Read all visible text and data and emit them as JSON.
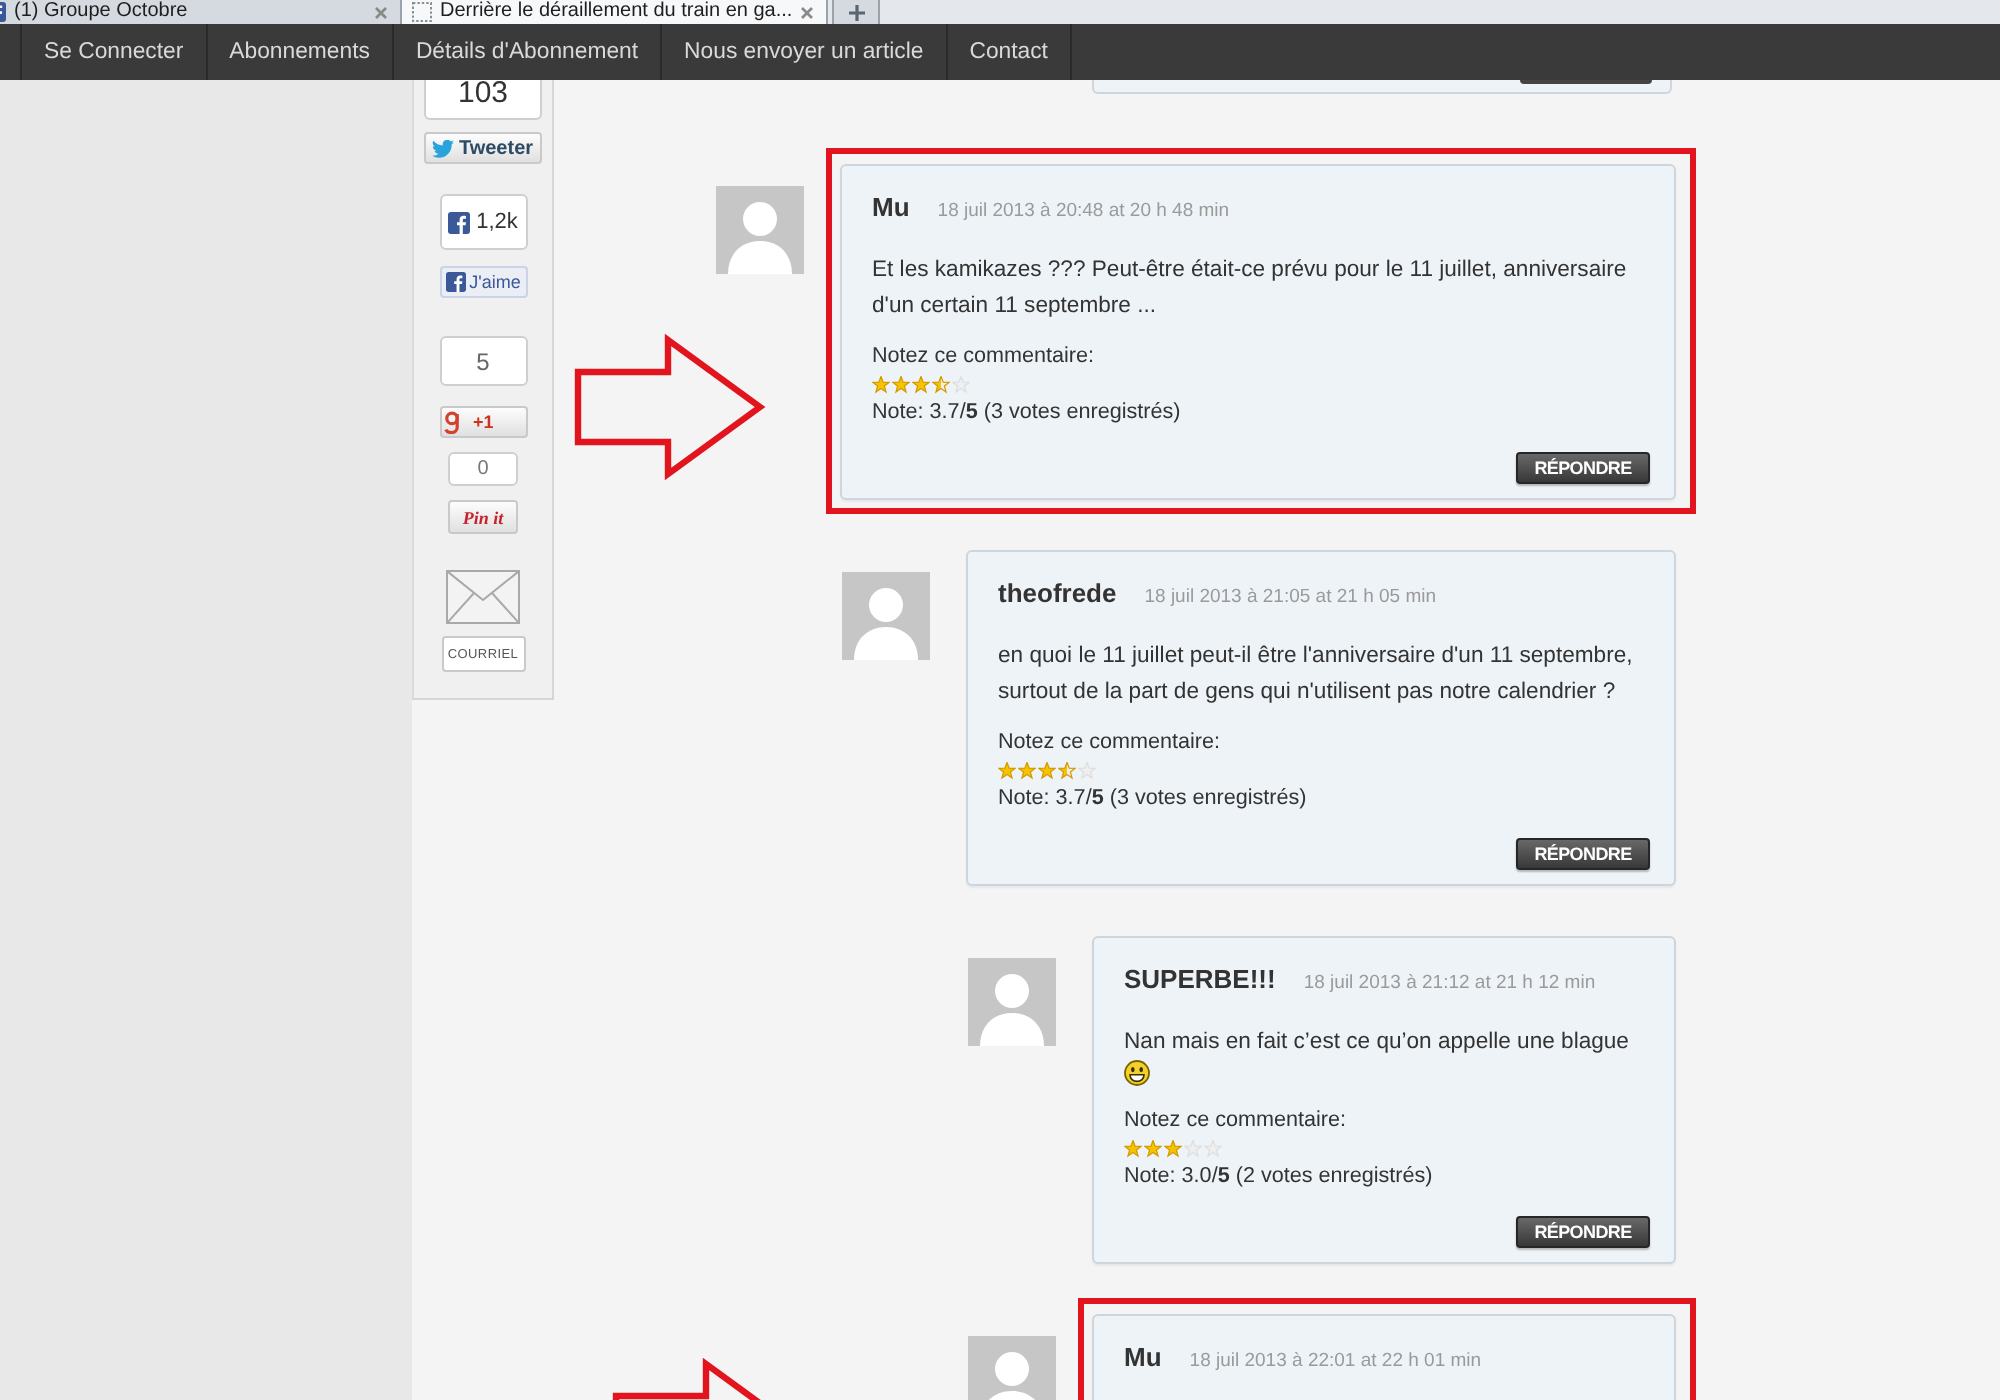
{
  "browser": {
    "tabs": [
      {
        "kind": "site",
        "title": "(1) Groupe Octobre",
        "selected": false
      },
      {
        "kind": "blank",
        "title": "Derrière le déraillement du train en ga...",
        "selected": true
      }
    ]
  },
  "nav": {
    "items": [
      "Se Connecter",
      "Abonnements",
      "Détails d'Abonnement",
      "Nous envoyer un article",
      "Contact"
    ]
  },
  "share_bar": [
    {
      "kind": "twitter",
      "count": "103",
      "label": "Tweeter"
    },
    {
      "kind": "facebook",
      "count": "1,2k",
      "label": "J'aime"
    },
    {
      "kind": "google",
      "count": "5",
      "label": "+1"
    },
    {
      "kind": "pinterest",
      "count": "0",
      "label": "Pin it"
    },
    {
      "kind": "email",
      "label": "COURRIEL"
    }
  ],
  "comments": [
    {
      "author": "Mu",
      "date": "18 juil 2013 à 20:48 at 20 h 48 min",
      "body": "Et les kamikazes ??? Peut-être était-ce prévu pour le 11 juillet, anniversaire d'un certain 11 septembre ...",
      "rating_prompt": "Notez ce commentaire:",
      "stars": 3.5,
      "note": "Note: 3.7/**5** (3 votes enregistrés)",
      "reply": "RÉPONDRE",
      "highlighted": true,
      "children": [
        {
          "author": "theofrede",
          "date": "18 juil 2013 à 21:05 at 21 h 05 min",
          "body": "en quoi le 11 juillet peut-il être l'anniversaire d'un 11 septembre, surtout de la part de gens qui n'utilisent pas notre calendrier ?",
          "rating_prompt": "Notez ce commentaire:",
          "stars": 3.5,
          "note": "Note: 3.7/**5** (3 votes enregistrés)",
          "reply": "RÉPONDRE",
          "highlighted": false,
          "children": [
            {
              "author": "SUPERBE!!!",
              "date": "18 juil 2013 à 21:12 at 21 h 12 min",
              "body": "Nan mais en fait c’est ce qu’on appelle une blague",
              "emoticon": true,
              "rating_prompt": "Notez ce commentaire:",
              "stars": 3,
              "note": "Note: 3.0/**5** (2 votes enregistrés)",
              "reply": "RÉPONDRE",
              "highlighted": false
            },
            {
              "author": "Mu",
              "date": "18 juil 2013 à 22:01 at 22 h 01 min",
              "highlighted": true
            }
          ]
        }
      ]
    }
  ]
}
